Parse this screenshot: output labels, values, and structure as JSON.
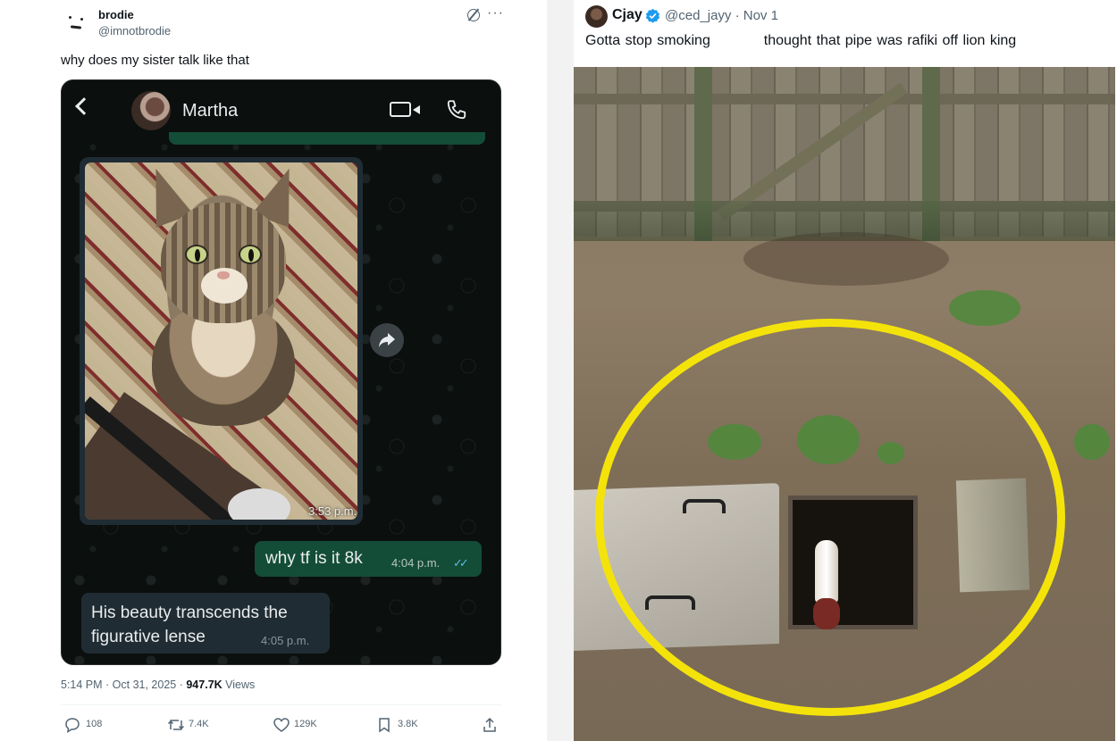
{
  "left_tweet": {
    "author_name": "brodie",
    "author_handle": "@imnotbrodie",
    "more_label": "···",
    "text": "why does my sister talk like that",
    "chat": {
      "contact_name": "Martha",
      "image_time": "3:53 p.m.",
      "outgoing_text": "why tf is it 8k",
      "outgoing_time": "4:04 p.m.",
      "outgoing_ticks": "✓✓",
      "incoming_text": "His beauty transcends the figurative lense",
      "incoming_time": "4:05 p.m.",
      "accent_color": "#144d37",
      "read_tick_color": "#53bdeb"
    },
    "timestamp": "5:14 PM · Oct 31, 2025 · ",
    "views_count": "947.7K",
    "views_label": " Views",
    "actions": {
      "replies": "108",
      "reposts": "7.4K",
      "likes": "129K",
      "bookmarks": "3.8K"
    }
  },
  "right_tweet": {
    "author_name": "Cjay",
    "author_handle": "@ced_jayy · Nov 1",
    "verified_color": "#1d9bf0",
    "text": "Gotta stop smoking           thought that pipe was rafiki off lion king",
    "highlight_color": "#f4e30b"
  }
}
